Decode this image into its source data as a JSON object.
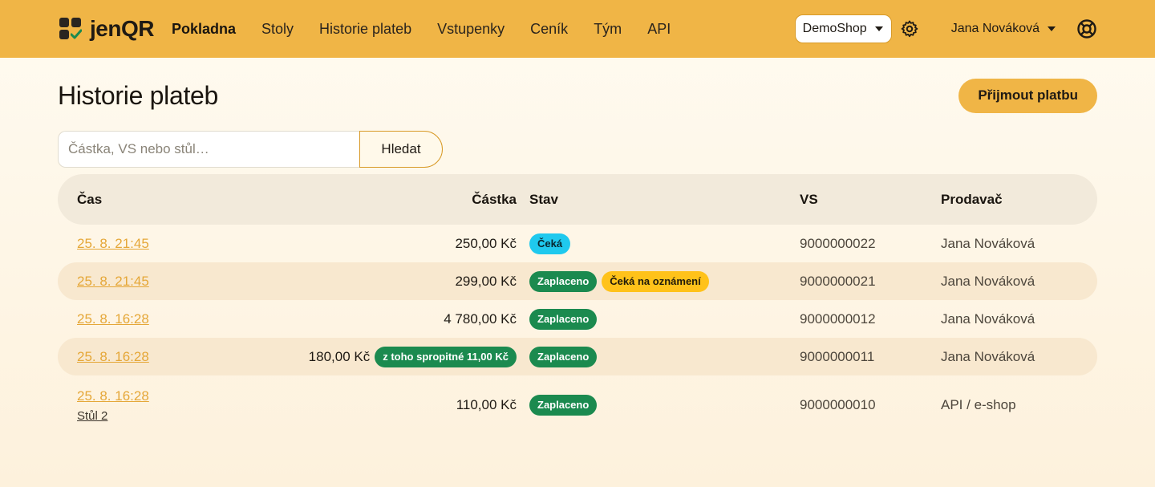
{
  "brand": {
    "name": "jenQR"
  },
  "nav": {
    "links": [
      "Pokladna",
      "Stoly",
      "Historie plateb",
      "Vstupenky",
      "Ceník",
      "Tým",
      "API"
    ],
    "shop": "DemoShop",
    "user": "Jana Nováková"
  },
  "page": {
    "title": "Historie plateb",
    "primary_button": "Přijmout platbu"
  },
  "search": {
    "placeholder": "Částka, VS nebo stůl…",
    "button": "Hledat"
  },
  "table": {
    "headers": {
      "time": "Čas",
      "amount": "Částka",
      "status": "Stav",
      "vs": "VS",
      "seller": "Prodavač"
    },
    "rows": [
      {
        "time": "25. 8. 21:45",
        "amount": "250,00 Kč",
        "status": [
          "Čeká"
        ],
        "vs": "9000000022",
        "seller": "Jana Nováková"
      },
      {
        "time": "25. 8. 21:45",
        "amount": "299,00 Kč",
        "status": [
          "Zaplaceno",
          "Čeká na oznámení"
        ],
        "vs": "9000000021",
        "seller": "Jana Nováková"
      },
      {
        "time": "25. 8. 16:28",
        "amount": "4 780,00 Kč",
        "status": [
          "Zaplaceno"
        ],
        "vs": "9000000012",
        "seller": "Jana Nováková"
      },
      {
        "time": "25. 8. 16:28",
        "amount": "180,00 Kč",
        "tip": "z toho spropitné 11,00 Kč",
        "status": [
          "Zaplaceno"
        ],
        "vs": "9000000011",
        "seller": "Jana Nováková"
      },
      {
        "time": "25. 8. 16:28",
        "sub": "Stůl 2",
        "amount": "110,00 Kč",
        "status": [
          "Zaplaceno"
        ],
        "vs": "9000000010",
        "seller": "API / e-shop"
      }
    ]
  },
  "colors": {
    "accent": "#f0b546",
    "status_pending": "#1fc9ee",
    "status_paid": "#1b8a4f",
    "status_awaiting": "#ffc21a"
  },
  "icons": [
    "logo-icon",
    "gear-icon",
    "support-icon",
    "caret-down-icon"
  ]
}
